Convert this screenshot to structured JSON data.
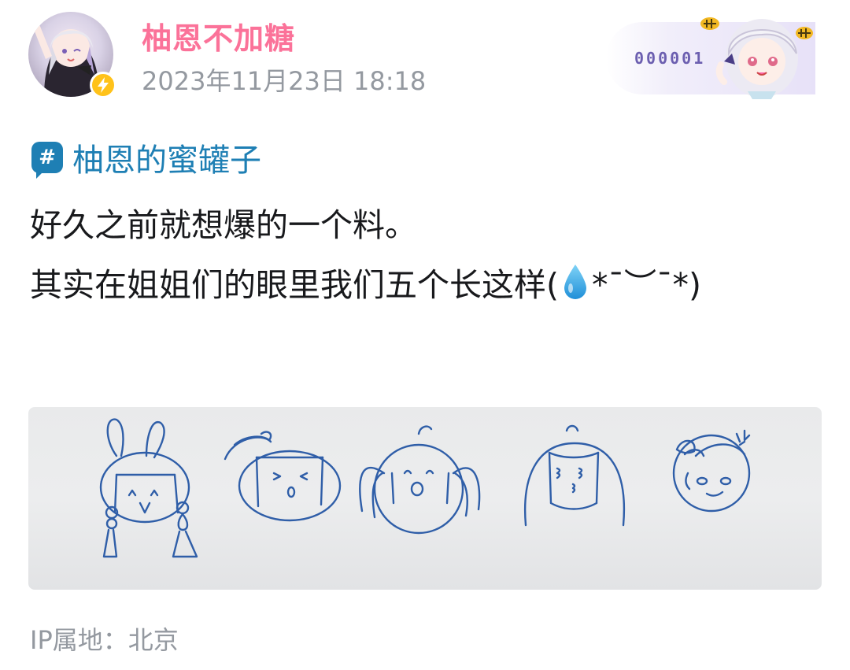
{
  "post": {
    "author": {
      "name": "柚恩不加糖",
      "verified_badge": "lightning-icon"
    },
    "timestamp": "2023年11月23日 18:18",
    "fan_card": {
      "number": "000001"
    },
    "topic": {
      "icon": "hashtag-icon",
      "label": "柚恩的蜜罐子"
    },
    "content": {
      "line1": "好久之前就想爆的一个料。",
      "line2_before_emoji": "其实在姐姐们的眼里我们五个长这样(",
      "line2_after_emoji": "*¯︶¯*)",
      "emoji": "water-drop-icon"
    },
    "image": {
      "subject": "hand-drawn doodle faces"
    },
    "ip_location": "IP属地：北京"
  },
  "colors": {
    "author_name": "#fb7299",
    "topic": "#1e7fb4",
    "meta_text": "#9499a0",
    "body_text": "#18191c",
    "badge": "#ffc21a"
  }
}
